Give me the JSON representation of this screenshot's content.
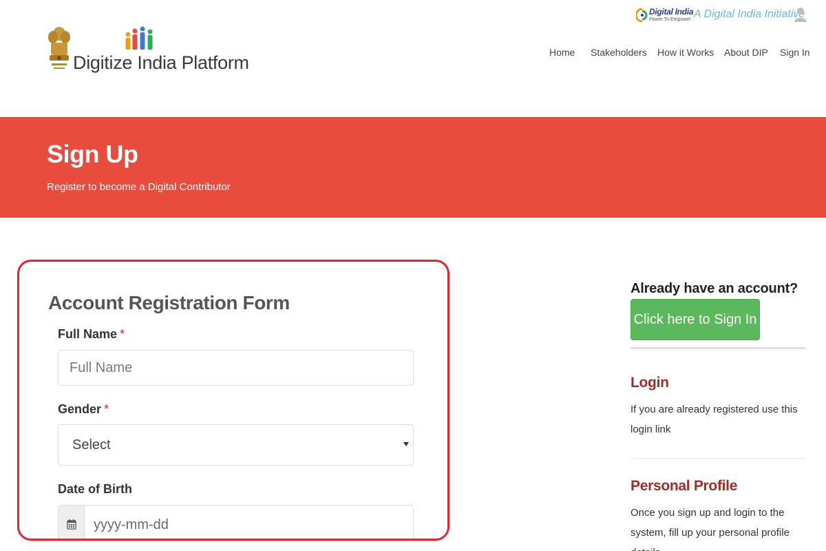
{
  "header": {
    "logo_text": "Digitize India Platform",
    "digital_india": {
      "name": "Digital India",
      "tagline": "Power To Empower",
      "initiative": "A Digital India Initiative"
    },
    "nav": [
      {
        "label": "Home"
      },
      {
        "label": "Stakeholders"
      },
      {
        "label": "How it Works"
      },
      {
        "label": "About DIP"
      },
      {
        "label": "Sign In"
      }
    ]
  },
  "banner": {
    "title": "Sign Up",
    "subtitle": "Register to become a Digital Contributor",
    "color": "#e84c3d"
  },
  "form": {
    "title": "Account Registration Form",
    "required_marker": "*",
    "full_name": {
      "label": "Full Name",
      "placeholder": "Full Name",
      "value": ""
    },
    "gender": {
      "label": "Gender",
      "selected": "Select"
    },
    "dob": {
      "label": "Date of Birth",
      "placeholder": "yyyy-mm-dd",
      "value": ""
    },
    "highlight_color": "#e3242b"
  },
  "sidebar": {
    "question": "Already have an account?",
    "signin_button": "Click here to Sign In",
    "signin_button_color": "#5cb85c",
    "sections": [
      {
        "title": "Login",
        "text": "If you are already registered use this login link"
      },
      {
        "title": "Personal Profile",
        "text": "Once you sign up and login to the system, fill up your personal profile details."
      }
    ],
    "heading_color": "#a52a2a"
  },
  "icons": {
    "emblem": "state-emblem-icon",
    "people": "people-logo-icon",
    "digital_india": "digital-india-logo-icon",
    "user": "user-icon",
    "calendar": "calendar-icon",
    "caret": "chevron-down-icon"
  }
}
